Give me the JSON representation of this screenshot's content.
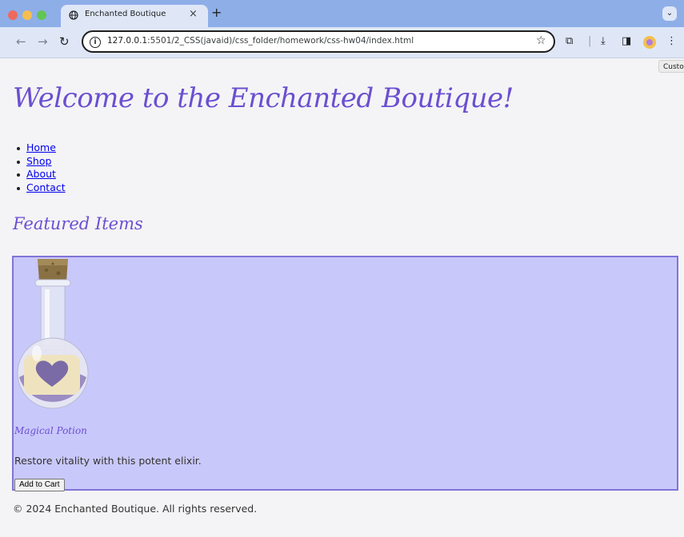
{
  "browser": {
    "tab_title": "Enchanted Boutique",
    "tab_close": "×",
    "new_tab": "+",
    "tab_search": "⌄",
    "url_host": "127.0.0.1",
    "url_path": ":5501/2_CSS(javaid)/css_folder/homework/css-hw04/index.html",
    "tooltip": "Custo",
    "icons": [
      "back-icon",
      "forward-icon",
      "reload-icon",
      "info-icon",
      "star-icon",
      "extensions-icon",
      "download-icon",
      "sidepanel-icon",
      "profile-icon",
      "menu-icon"
    ]
  },
  "page": {
    "title": "Welcome to the Enchanted Boutique!",
    "nav": [
      "Home",
      "Shop",
      "About",
      "Contact"
    ],
    "section_title": "Featured Items",
    "product": {
      "name": "Magical Potion",
      "description": "Restore vitality with this potent elixir.",
      "button": "Add to Cart"
    },
    "footer": "© 2024 Enchanted Boutique. All rights reserved."
  },
  "colors": {
    "accent": "#6b4fd1",
    "card_bg": "#c9c8fb",
    "card_border": "#8074d6",
    "link": "#0000ee"
  }
}
